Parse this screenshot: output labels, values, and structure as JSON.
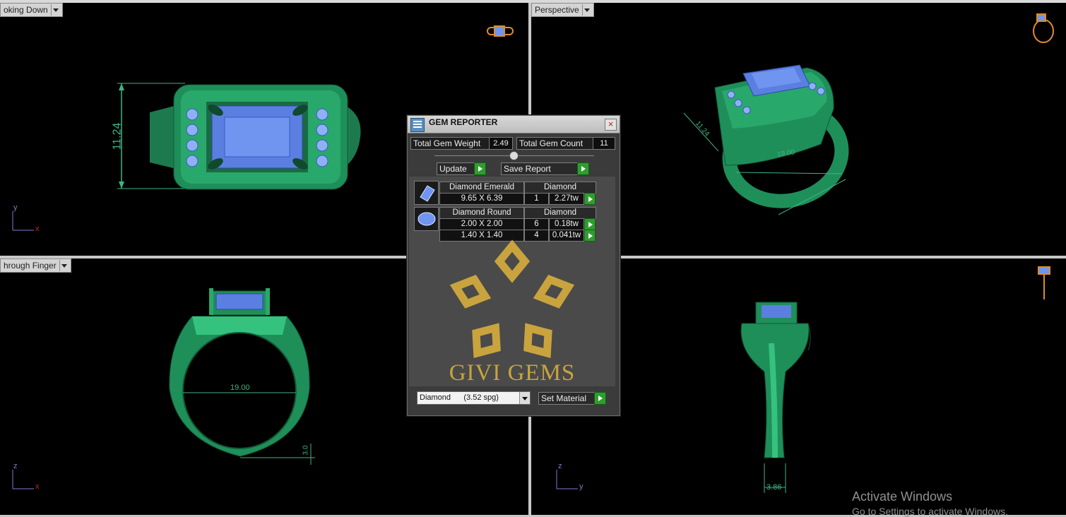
{
  "viewports": {
    "top_left": {
      "label": "oking Down"
    },
    "top_right": {
      "label": "Perspective"
    },
    "bottom_left": {
      "label": "hrough Finger"
    },
    "bottom_right": {
      "label": ""
    }
  },
  "dimensions": {
    "width_top": "11.24",
    "persp_a": "11.24",
    "persp_b": "19.00",
    "front_inner": "19.00",
    "front_band": "3.0",
    "side_band": "3.86"
  },
  "axes": {
    "x": "x",
    "y": "y",
    "z": "z"
  },
  "dialog": {
    "title": "GEM REPORTER",
    "total_weight_label": "Total Gem Weight",
    "total_weight_value": "2.49",
    "total_count_label": "Total Gem Count",
    "total_count_value": "11",
    "update_label": "Update",
    "save_report_label": "Save Report",
    "gems": [
      {
        "name": "Diamond Emerald",
        "material": "Diamond",
        "rows": [
          {
            "size": "9.65 X 6.39",
            "count": "1",
            "weight": "2.27tw"
          }
        ]
      },
      {
        "name": "Diamond Round",
        "material": "Diamond",
        "rows": [
          {
            "size": "2.00 X 2.00",
            "count": "6",
            "weight": "0.18tw"
          },
          {
            "size": "1.40 X 1.40",
            "count": "4",
            "weight": "0.041tw"
          }
        ]
      }
    ],
    "logo_text": "GIVI GEMS",
    "material_select": "Diamond      (3.52 spg)",
    "set_material_label": "Set Material"
  },
  "watermark": {
    "line1": "Activate Windows",
    "line2": "Go to Settings to activate Windows."
  },
  "colors": {
    "metal": "#1f8f5a",
    "metal_light": "#35c27f",
    "gem": "#5a7fe0",
    "dim": "#3fb383",
    "logo_gold": "#c9a33d"
  }
}
